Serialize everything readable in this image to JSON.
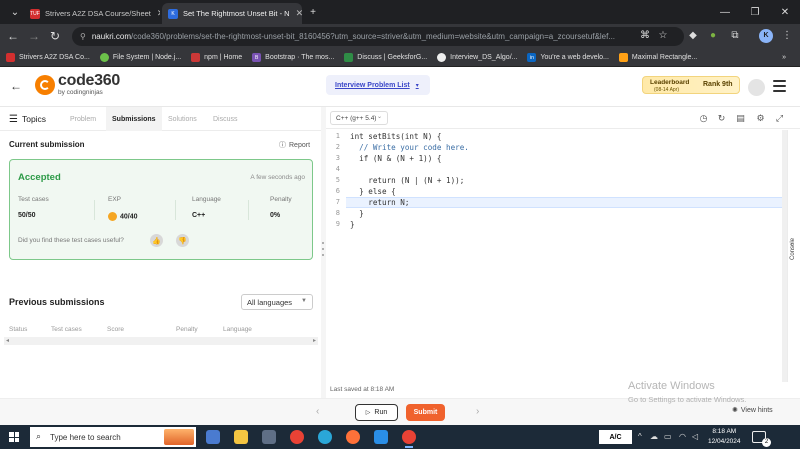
{
  "browser": {
    "tabs": [
      {
        "title": "Strivers A2Z DSA Course/Sheet",
        "favicon": "tuf-icon"
      },
      {
        "title": "Set The Rightmost Unset Bit - N",
        "favicon": "k-icon"
      }
    ],
    "url_host": "naukri.com",
    "url_path": "/code360/problems/set-the-rightmost-unset-bit_8160456?utm_source=striver&utm_medium=website&utm_campaign=a_zcoursetuf&lef...",
    "profile_initial": "K",
    "bookmarks": [
      "Strivers A2Z DSA Co...",
      "File System | Node.j...",
      "npm | Home",
      "Bootstrap · The mos...",
      "Discuss | GeeksforG...",
      "Interview_DS_Algo/...",
      "You're a web develo...",
      "Maximal Rectangle..."
    ],
    "more_bookmarks": "»"
  },
  "site": {
    "logo_text": "code360",
    "logo_sub": "by codingninjas",
    "problem_list": "Interview Problem List",
    "leaderboard": "Leaderboard",
    "leaderboard_date": "(08-14 Apr)",
    "rank": "Rank 9th"
  },
  "left_panel": {
    "topics": "Topics",
    "tabs": [
      "Problem",
      "Submissions",
      "Solutions",
      "Discuss"
    ],
    "active_tab": "Submissions",
    "current_submission": "Current submission",
    "report": "Report",
    "status": "Accepted",
    "time_ago": "A few seconds ago",
    "stats": [
      {
        "label": "Test cases",
        "value": "50/50"
      },
      {
        "label": "EXP",
        "value": "40/40"
      },
      {
        "label": "Language",
        "value": "C++"
      },
      {
        "label": "Penalty",
        "value": "0%"
      }
    ],
    "feedback_question": "Did you find these test cases useful?",
    "previous_submissions": "Previous submissions",
    "language_filter": "All languages",
    "table_headers": [
      "Status",
      "Test cases",
      "Score",
      "Penalty",
      "Language"
    ]
  },
  "editor": {
    "language": "C++ (g++ 5.4)",
    "line_numbers": [
      "1",
      "2",
      "3",
      "4",
      "5",
      "6",
      "7",
      "8",
      "9"
    ],
    "lines": [
      "int setBits(int N) {",
      "  // Write your code here.",
      "  if (N & (N + 1)) {",
      "",
      "    return (N | (N + 1));",
      "  } else {",
      "    return N;",
      "  }",
      "}"
    ],
    "last_saved": "Last saved at 8:18 AM",
    "console_label": "Console"
  },
  "actions": {
    "run": "Run",
    "submit": "Submit",
    "view_hints": "View hints"
  },
  "watermark": {
    "line1": "Activate Windows",
    "line2": "Go to Settings to activate Windows."
  },
  "taskbar": {
    "search_placeholder": "Type here to search",
    "keyboard": "A/C",
    "time": "8:18 AM",
    "date": "12/04/2024",
    "notifications": "2"
  },
  "colors": {
    "accent_orange": "#f0622d",
    "accepted_green": "#2c9a47",
    "link_blue": "#3a46c8"
  }
}
